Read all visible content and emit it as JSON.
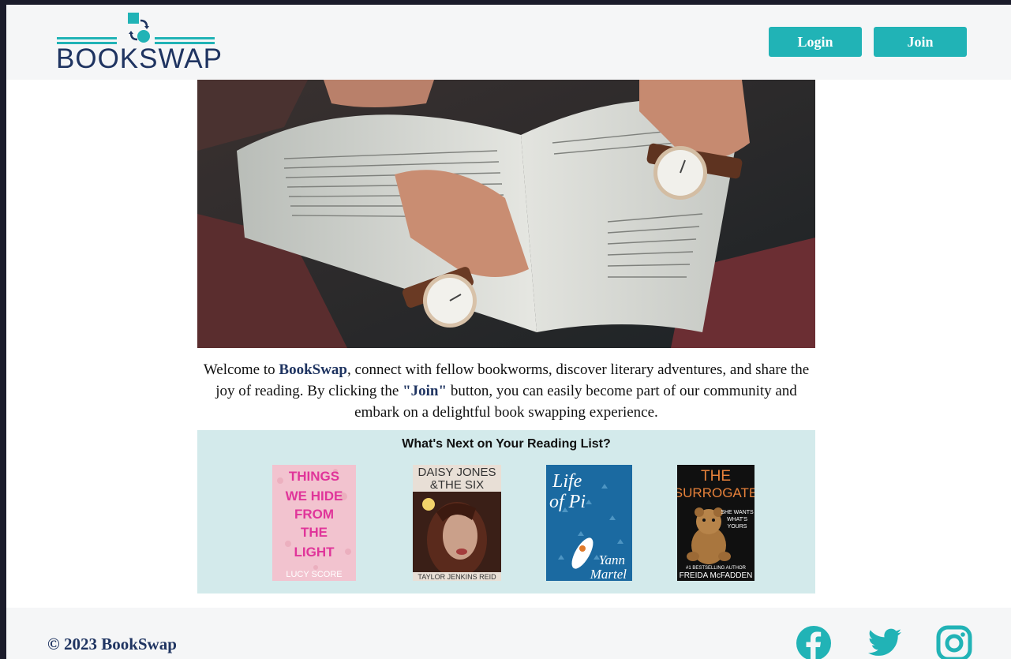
{
  "brand": {
    "name": "BOOKSWAP",
    "primary_color": "#1f3461",
    "accent_color": "#21b3b6"
  },
  "header": {
    "login_label": "Login",
    "join_label": "Join"
  },
  "intro": {
    "part1": "Welcome to ",
    "brand": "BookSwap",
    "part2": ", connect with fellow bookworms, discover literary adventures, and share the joy of reading. By clicking the ",
    "join_quote": "\"Join\"",
    "part3": " button, you can easily become part of our community and embark on a delightful book swapping experience."
  },
  "reading_list": {
    "title": "What's Next on Your Reading List?",
    "books": [
      {
        "cover_lines": [
          "THINGS",
          "WE HIDE",
          "FROM",
          "THE",
          "LIGHT"
        ],
        "author": "LUCY SCORE"
      },
      {
        "cover_lines": [
          "DAISY JONES",
          "&THE SIX"
        ],
        "author": "TAYLOR JENKINS REID"
      },
      {
        "cover_lines": [
          "Life",
          "of Pi"
        ],
        "author_lines": [
          "Yann",
          "Martel"
        ]
      },
      {
        "cover_lines": [
          "THE",
          "SURROGATE"
        ],
        "tagline": [
          "SHE WANTS",
          "WHAT'S",
          "YOURS"
        ],
        "author_prefix": "#1 BESTSELLING AUTHOR",
        "author": "FREIDA McFADDEN"
      }
    ]
  },
  "footer": {
    "copyright": "© 2023 BookSwap",
    "social_icons": [
      "facebook-icon",
      "twitter-icon",
      "instagram-icon"
    ]
  }
}
